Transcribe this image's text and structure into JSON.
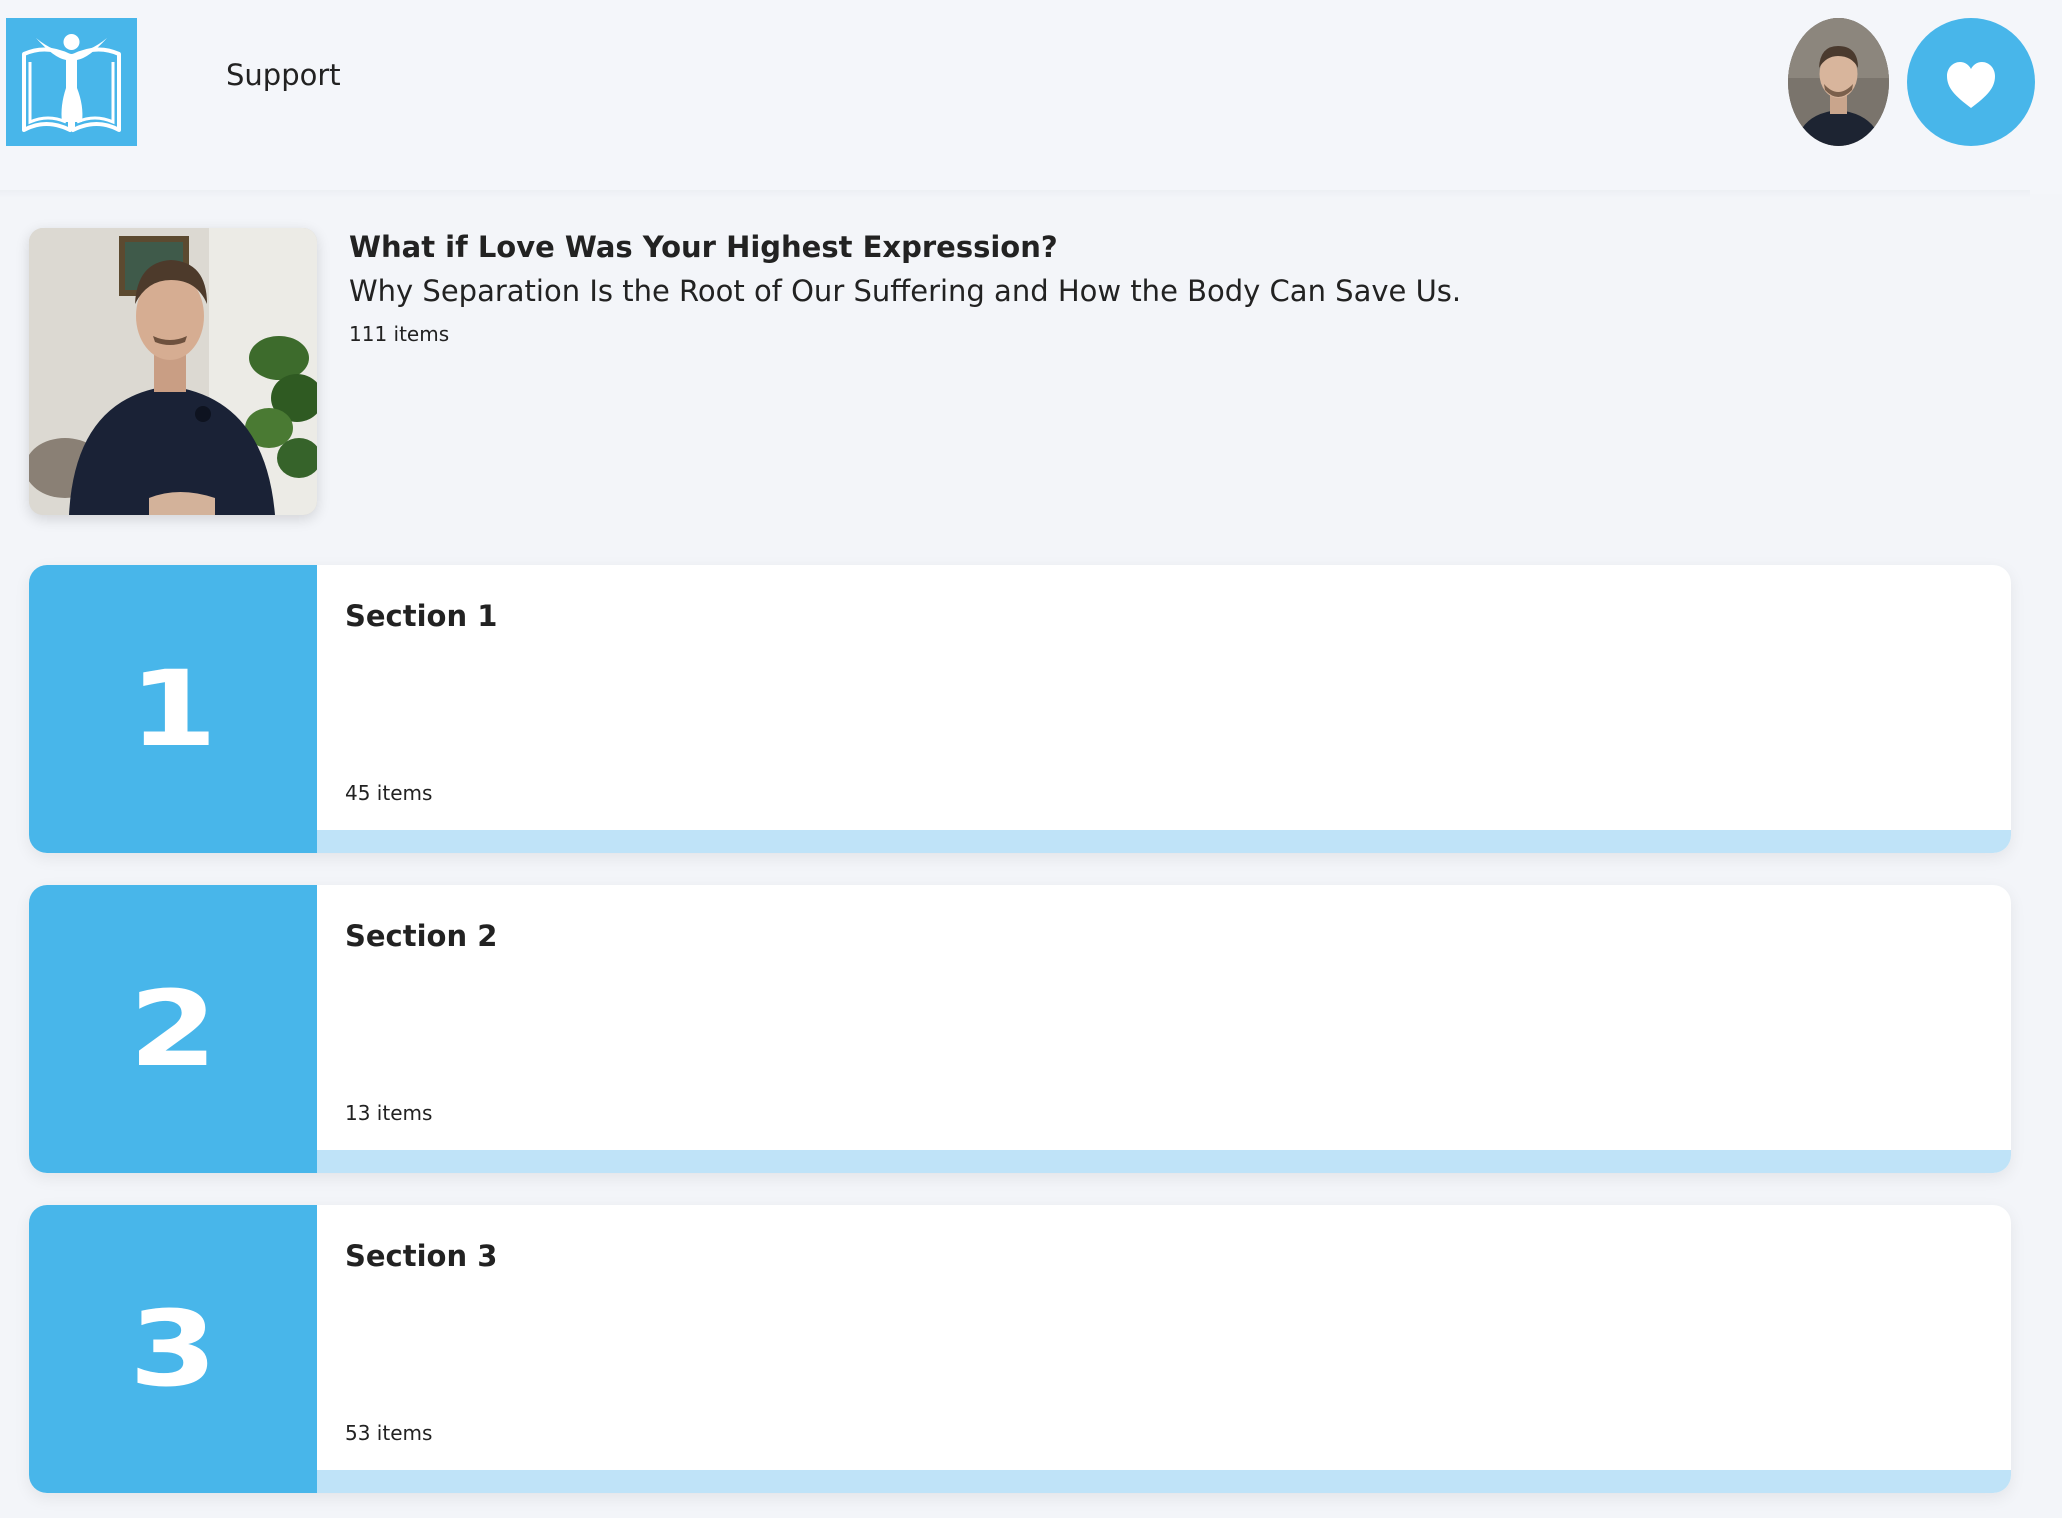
{
  "header": {
    "support_label": "Support"
  },
  "course": {
    "title": "What if Love Was Your Highest Expression?",
    "subtitle": "Why Separation Is the Root of Our Suffering and How the Body Can Save Us.",
    "item_count": "111 items"
  },
  "sections": [
    {
      "number": "1",
      "name": "Section 1",
      "item_count": "45 items",
      "progress": 0
    },
    {
      "number": "2",
      "name": "Section 2",
      "item_count": "13 items",
      "progress": 0
    },
    {
      "number": "3",
      "name": "Section 3",
      "item_count": "53 items",
      "progress": 0
    }
  ],
  "colors": {
    "accent": "#48b6ea",
    "progress_track": "#bfe3f8",
    "background": "#f3f5f9",
    "card": "#ffffff",
    "text": "#222222"
  },
  "icons": {
    "logo": "book-figure-logo-icon",
    "heart": "heart-icon"
  }
}
